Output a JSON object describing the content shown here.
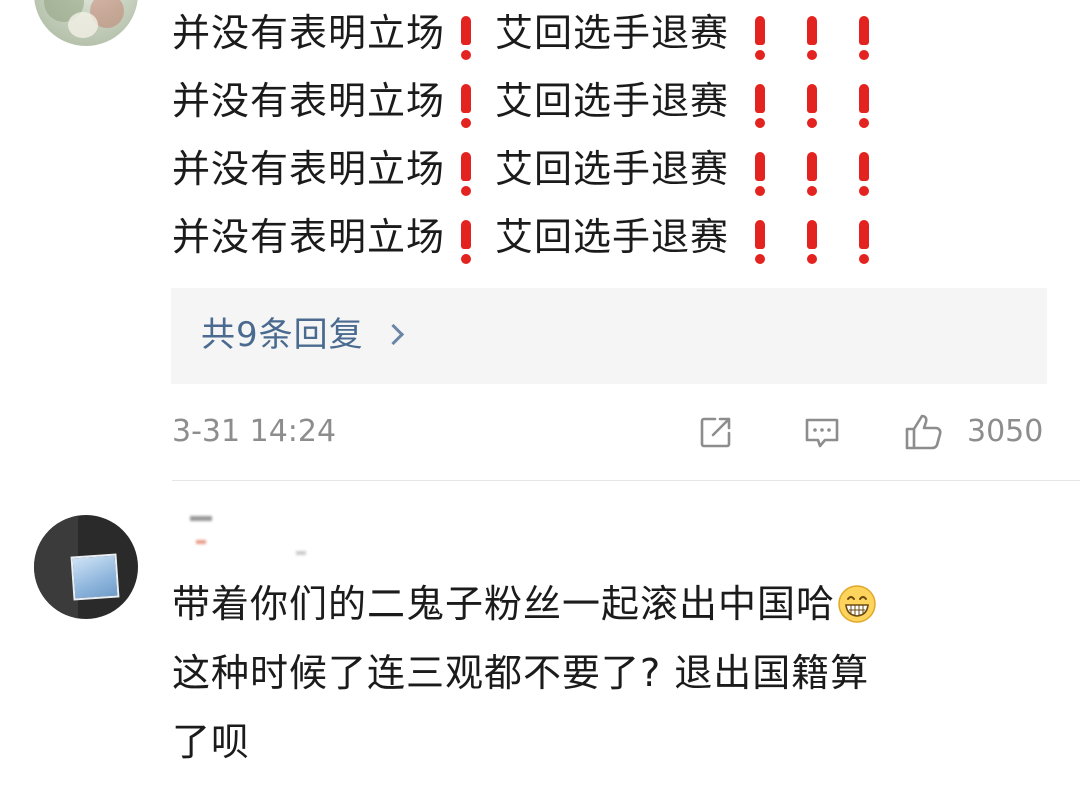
{
  "comment_1": {
    "lines": [
      {
        "left": "并没有表明立场",
        "right": "艾回选手退赛"
      },
      {
        "left": "并没有表明立场",
        "right": "艾回选手退赛"
      },
      {
        "left": "并没有表明立场",
        "right": "艾回选手退赛"
      },
      {
        "left": "并没有表明立场",
        "right": "艾回选手退赛"
      }
    ],
    "replies_label": "共9条回复",
    "timestamp": "3-31 14:24",
    "like_count": "3050"
  },
  "comment_2": {
    "lines": [
      "带着你们的二鬼子粉丝一起滚出中国哈",
      "这种时候了连三观都不要了? 退出国籍算",
      "了呗"
    ]
  },
  "icons": {
    "share": "share-icon",
    "comment": "comment-icon",
    "like": "thumbs-up-icon",
    "emphasis": "exclamation-icon",
    "emoji": "grinning-face-icon",
    "chevron": "chevron-right-icon"
  },
  "colors": {
    "exclamation": "#e3231f",
    "link": "#4a6b8f",
    "meta": "#8d8d8d",
    "reply_bg": "#f5f5f5"
  }
}
